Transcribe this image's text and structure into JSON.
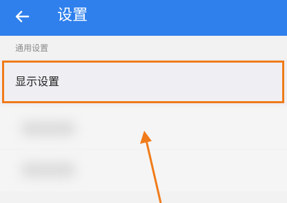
{
  "app_bar": {
    "title": "设置",
    "back_icon": "arrow-back-icon",
    "color": "#2f80ed"
  },
  "section": {
    "header": "通用设置"
  },
  "items": [
    {
      "label": "显示设置"
    }
  ],
  "annotation": {
    "highlight_color": "#f07b1a"
  }
}
